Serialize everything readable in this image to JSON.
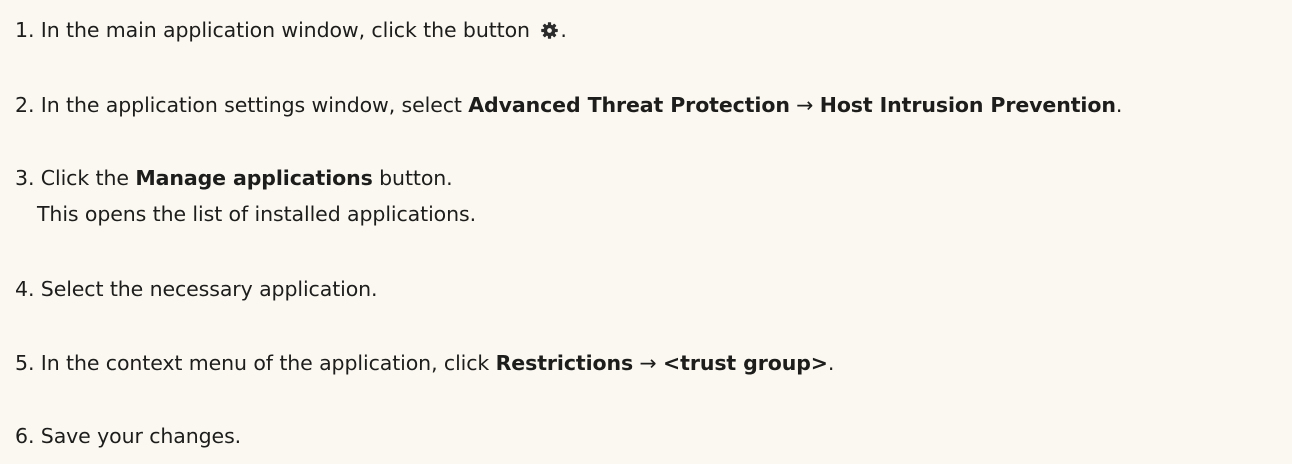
{
  "steps": [
    {
      "num": "1.",
      "a": " In the main application window, click the button ",
      "icon": "gear-icon",
      "b": "."
    },
    {
      "num": "2.",
      "a": " In the application settings window, select ",
      "bold1": "Advanced Threat Protection",
      "arrow": " → ",
      "bold2": "Host Intrusion Prevention",
      "b": "."
    },
    {
      "num": "3.",
      "a": " Click the ",
      "bold1": "Manage applications",
      "b": " button.",
      "note": "This opens the list of installed applications."
    },
    {
      "num": "4.",
      "a": " Select the necessary application."
    },
    {
      "num": "5.",
      "a": " In the context menu of the application, click ",
      "bold1": "Restrictions",
      "arrow": " → ",
      "bold2": "<trust group>",
      "b": "."
    },
    {
      "num": "6.",
      "a": " Save your changes."
    }
  ]
}
